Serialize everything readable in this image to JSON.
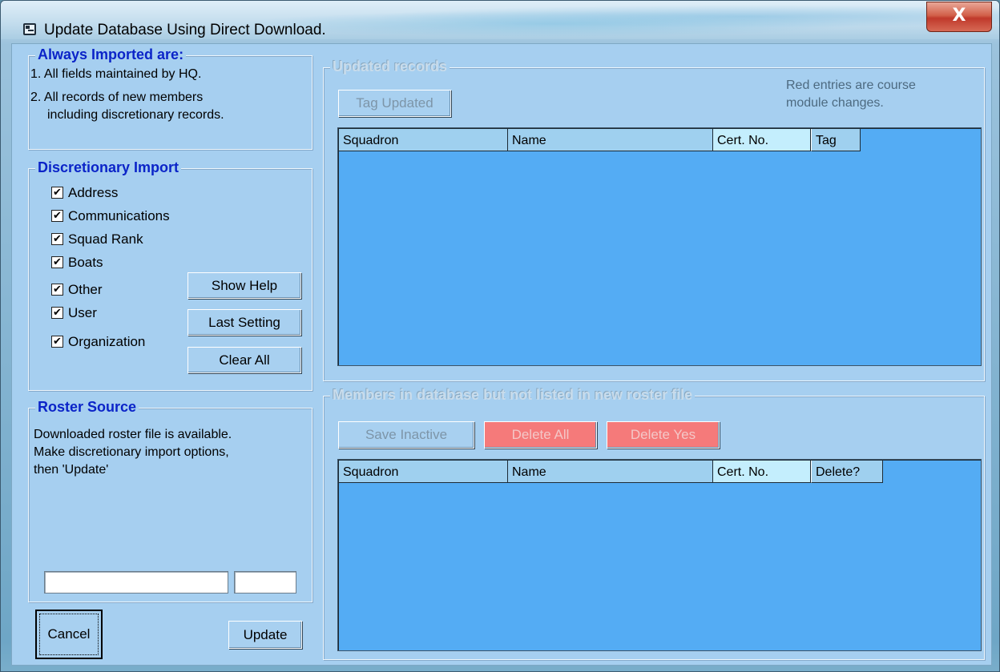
{
  "window": {
    "title": "Update Database Using Direct Download.",
    "close_label": "X"
  },
  "always_imported": {
    "legend": "Always Imported are:",
    "line1": "1. All fields maintained by HQ.",
    "line2": "2. All records of new members",
    "line3": "including discretionary records."
  },
  "discretionary": {
    "legend": "Discretionary Import",
    "items": [
      {
        "label": "Address",
        "checked": true
      },
      {
        "label": "Communications",
        "checked": true
      },
      {
        "label": "Squad Rank",
        "checked": true
      },
      {
        "label": "Boats",
        "checked": true
      },
      {
        "label": "Other",
        "checked": true
      },
      {
        "label": "User",
        "checked": true
      },
      {
        "label": "Organization",
        "checked": true
      }
    ],
    "check_mark": "✔",
    "show_help": "Show Help",
    "last_setting": "Last Setting",
    "clear_all": "Clear All"
  },
  "roster": {
    "legend": "Roster Source",
    "line1": "Downloaded roster file is available.",
    "line2": "Make discretionary import options,",
    "line3": "then 'Update'",
    "file_value": "",
    "count_value": ""
  },
  "footer": {
    "cancel": "Cancel",
    "update": "Update"
  },
  "updated": {
    "legend": "Updated records",
    "tag_updated": "Tag Updated",
    "note_line1": "Red entries are course",
    "note_line2": "module changes.",
    "columns": [
      "Squadron",
      "Name",
      "Cert. No.",
      "Tag"
    ]
  },
  "missing": {
    "legend": "Members in database but not listed in new roster file",
    "save_inactive": "Save Inactive",
    "delete_all": "Delete All",
    "delete_yes": "Delete Yes",
    "columns": [
      "Squadron",
      "Name",
      "Cert. No.",
      "Delete?"
    ]
  }
}
